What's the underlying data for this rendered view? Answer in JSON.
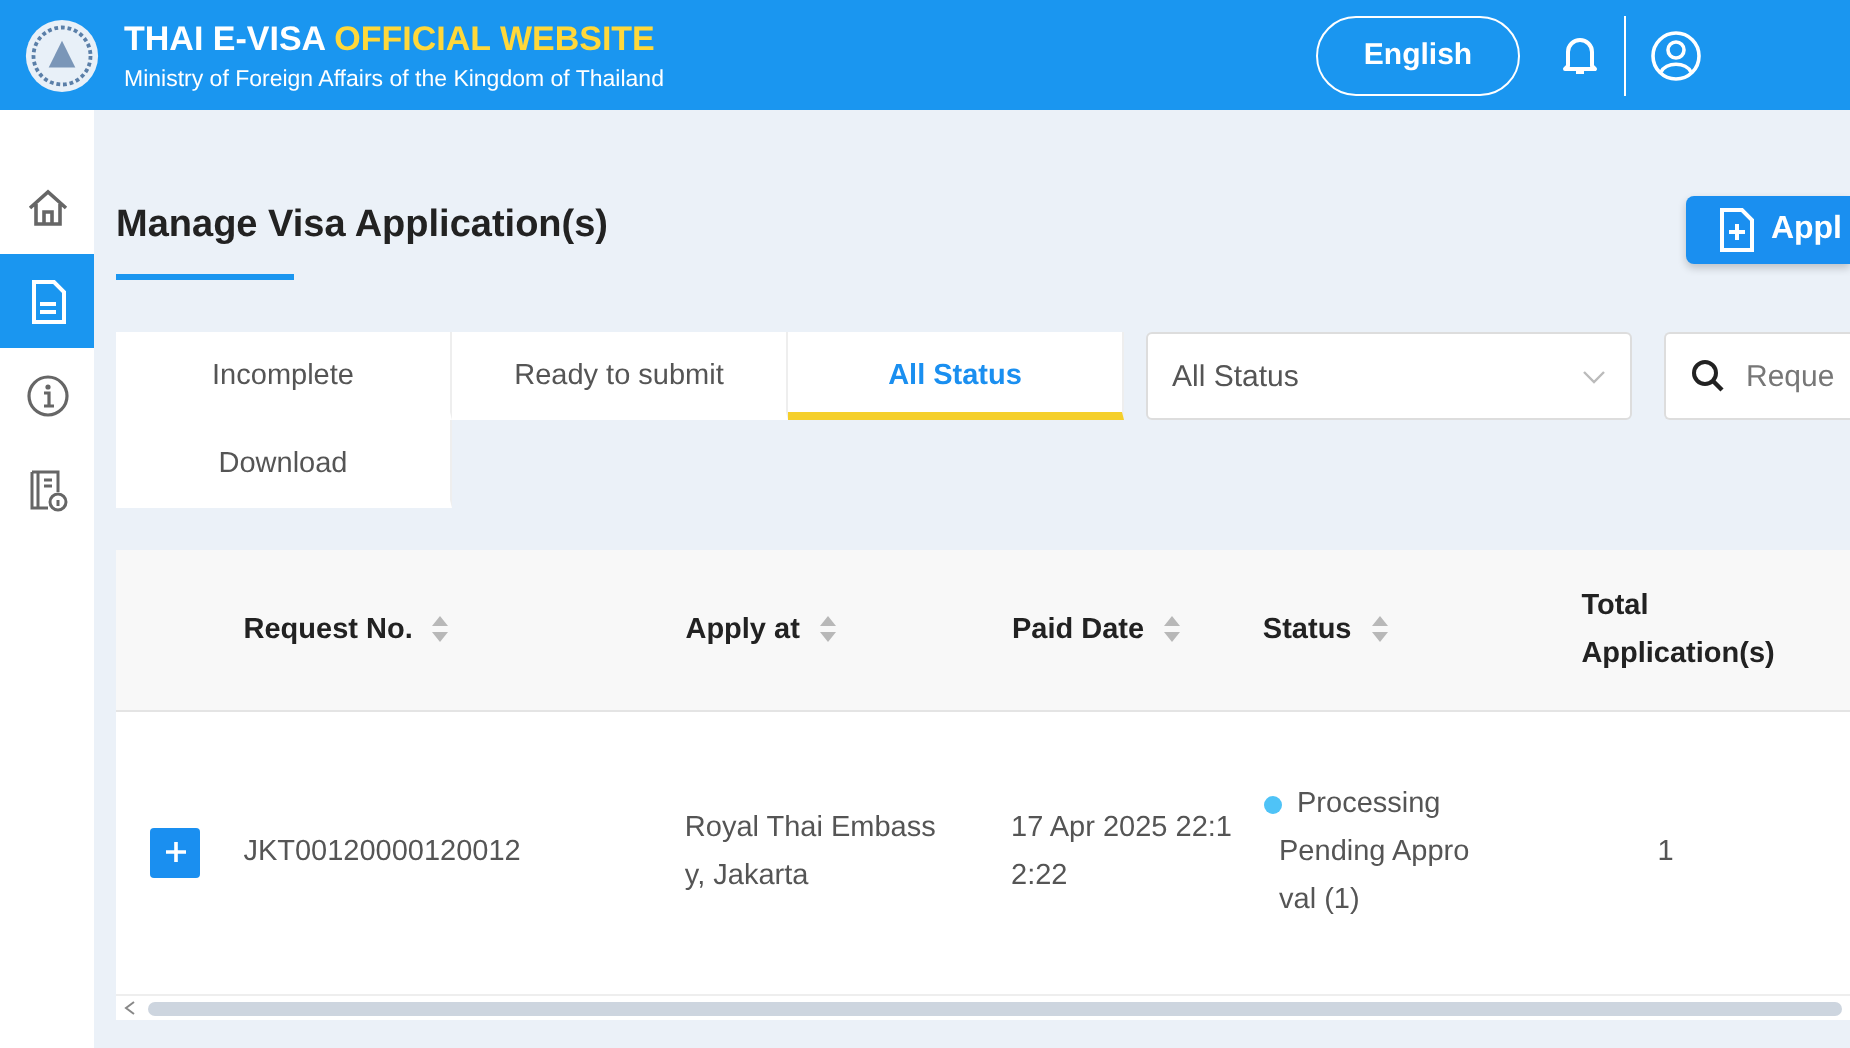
{
  "header": {
    "title": "THAI E-VISA",
    "title_highlight": "OFFICIAL WEBSITE",
    "subtitle": "Ministry of Foreign Affairs of the Kingdom of Thailand",
    "language_button": "English"
  },
  "sidebar": {
    "items": [
      {
        "kind": "home",
        "selected": false
      },
      {
        "kind": "document",
        "selected": true
      },
      {
        "kind": "info",
        "selected": false
      },
      {
        "kind": "manual",
        "selected": false
      }
    ]
  },
  "page_title": "Manage Visa Application(s)",
  "apply_button": "Appl",
  "tabs": [
    {
      "label": "Incomplete",
      "selected": false
    },
    {
      "label": "Ready to submit",
      "selected": false
    },
    {
      "label": "All Status",
      "selected": true
    },
    {
      "label": "Download",
      "selected": false
    }
  ],
  "status_filter": {
    "value": "All Status"
  },
  "search": {
    "placeholder": "Reque"
  },
  "table": {
    "columns": [
      "Request No.",
      "Apply at",
      "Paid Date",
      "Status",
      "Total Application(s)"
    ],
    "rows": [
      {
        "request_no": "JKT00120000120012",
        "apply_at": "Royal Thai Embassy, Jakarta",
        "paid_date": "17 Apr 2025 22:12:22",
        "status": "Processing",
        "color": "#4fc3f7",
        "status_detail": "Pending Approval (1)",
        "total": "1"
      }
    ]
  }
}
